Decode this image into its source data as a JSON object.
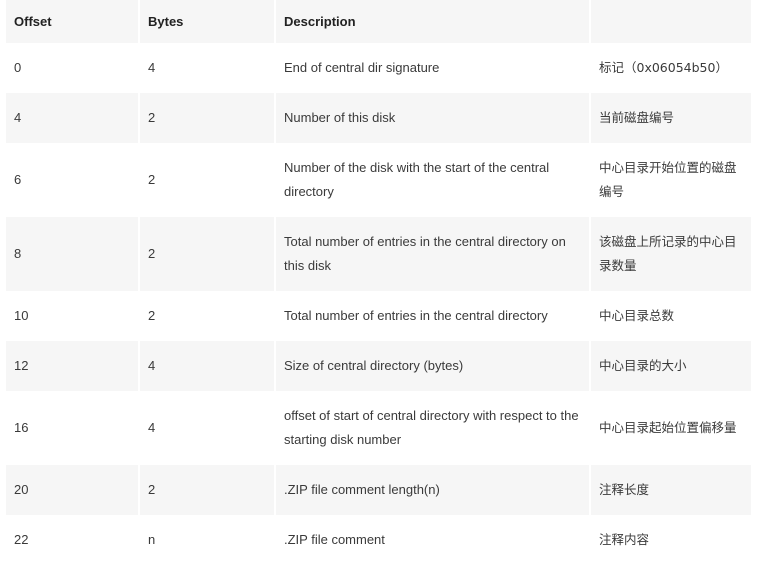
{
  "table": {
    "headers": [
      "Offset",
      "Bytes",
      "Description",
      ""
    ],
    "rows": [
      {
        "offset": "0",
        "bytes": "4",
        "description": "End of central dir signature",
        "note": "标记（0x06054b50）"
      },
      {
        "offset": "4",
        "bytes": "2",
        "description": "Number of this disk",
        "note": "当前磁盘编号"
      },
      {
        "offset": "6",
        "bytes": "2",
        "description": "Number of the disk with the start of the central directory",
        "note": "中心目录开始位置的磁盘编号"
      },
      {
        "offset": "8",
        "bytes": "2",
        "description": "Total number of entries in the central directory on this disk",
        "note": "该磁盘上所记录的中心目录数量"
      },
      {
        "offset": "10",
        "bytes": "2",
        "description": "Total number of entries in the central directory",
        "note": "中心目录总数"
      },
      {
        "offset": "12",
        "bytes": "4",
        "description": "Size of central directory (bytes)",
        "note": "中心目录的大小"
      },
      {
        "offset": "16",
        "bytes": "4",
        "description": "offset of start of central directory with respect to the starting disk number",
        "note": "中心目录起始位置偏移量"
      },
      {
        "offset": "20",
        "bytes": "2",
        "description": ".ZIP file comment length(n)",
        "note": "注释长度"
      },
      {
        "offset": "22",
        "bytes": "n",
        "description": ".ZIP file comment",
        "note": "注释内容"
      }
    ]
  }
}
